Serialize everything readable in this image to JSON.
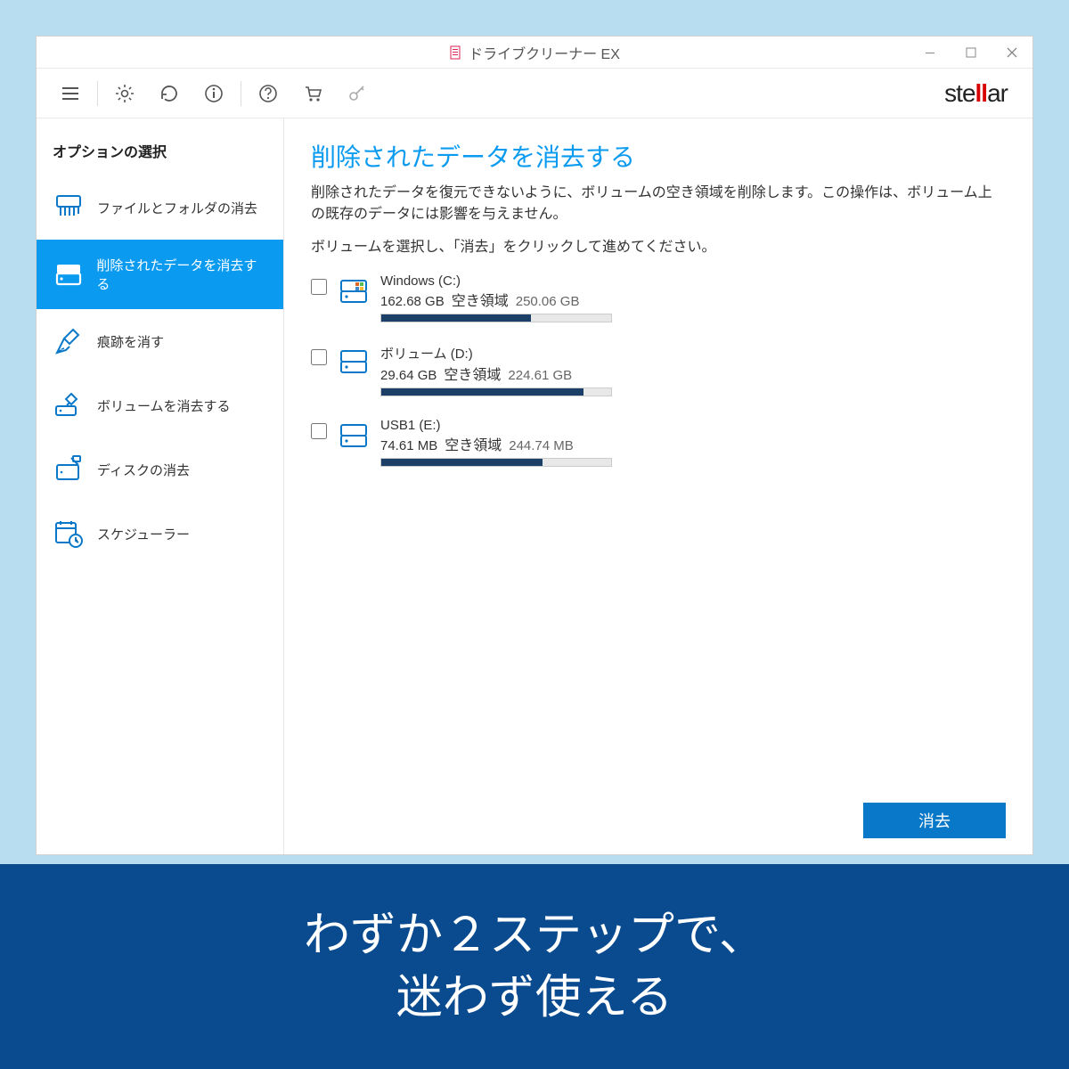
{
  "window": {
    "title": "ドライブクリーナー EX"
  },
  "logo": {
    "pre": "ste",
    "mid": "ll",
    "post": "ar"
  },
  "sidebar": {
    "title": "オプションの選択",
    "items": [
      {
        "label": "ファイルとフォルダの消去"
      },
      {
        "label": "削除されたデータを消去する"
      },
      {
        "label": "痕跡を消す"
      },
      {
        "label": "ボリュームを消去する"
      },
      {
        "label": "ディスクの消去"
      },
      {
        "label": "スケジューラー"
      }
    ]
  },
  "main": {
    "title": "削除されたデータを消去する",
    "description": "削除されたデータを復元できないように、ボリュームの空き領域を削除します。この操作は、ボリューム上の既存のデータには影響を与えません。",
    "instruction": "ボリュームを選択し、「消去」をクリックして進めてください。",
    "free_label": "空き領域"
  },
  "volumes": [
    {
      "name": "Windows (C:)",
      "used": "162.68 GB",
      "total": "250.06 GB",
      "fill_pct": 65
    },
    {
      "name": "ボリューム (D:)",
      "used": "29.64 GB",
      "total": "224.61 GB",
      "fill_pct": 88
    },
    {
      "name": "USB1 (E:)",
      "used": "74.61 MB",
      "total": "244.74 MB",
      "fill_pct": 70
    }
  ],
  "footer": {
    "erase_button": "消去"
  },
  "caption": {
    "line1": "わずか２ステップで、",
    "line2": "迷わず使える"
  }
}
